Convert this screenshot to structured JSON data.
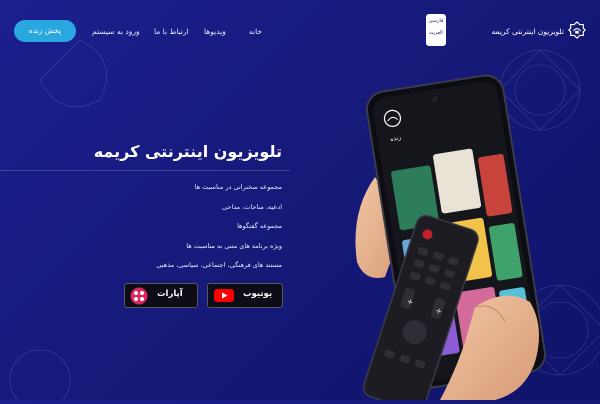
{
  "header": {
    "live_button": "پخش زنده",
    "nav": [
      "ورود به سیستم",
      "ارتباط با ما",
      "ویدیوها",
      "خانه"
    ],
    "lang_badge": [
      "فارسی",
      "العربیة"
    ],
    "brand_name": "تلویزیون اینترنتی کریمه"
  },
  "hero": {
    "title": "تلویزیون اینترنتی کریمه",
    "features": [
      "مجموعه سخنرانی در مناسبت ها",
      "ادعیه، مناجات، مداحی",
      "مجموعه گفتگوها",
      "ویژه برنامه های متنی به مناسبت ها",
      "مستند های فرهنگی، اجتماعی، سیاسی، مذهبی"
    ]
  },
  "stores": [
    {
      "name": "آپارات",
      "icon": "aparat-icon"
    },
    {
      "name": "یوتیوب",
      "icon": "youtube-play-icon"
    }
  ],
  "phone": {
    "screen_label": "زنده"
  },
  "colors": {
    "accent": "#2ba7e0",
    "background": "#161a7a",
    "aparat": "#e0245e",
    "youtube": "#ff0000"
  }
}
